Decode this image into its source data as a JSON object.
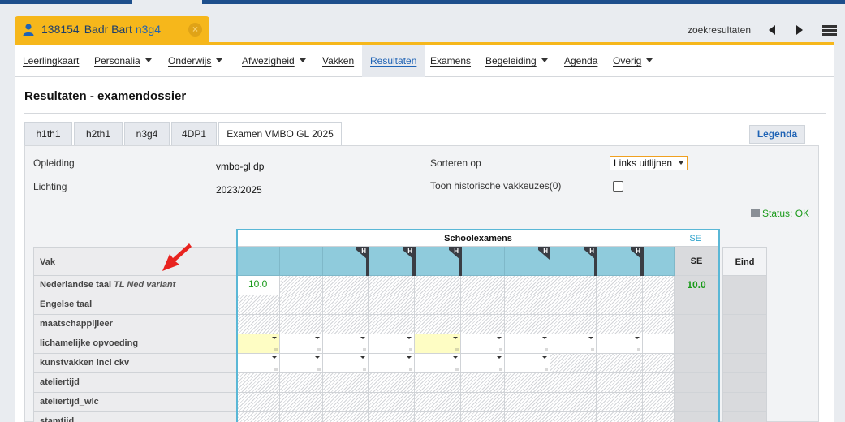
{
  "student": {
    "number": "138154",
    "name": "Badr Bart",
    "class": "n3g4"
  },
  "toolbar": {
    "search_results": "zoekresultaten"
  },
  "menu": [
    {
      "label": "Leerlingkaart",
      "has_caret": false
    },
    {
      "label": "Personalia",
      "has_caret": true
    },
    {
      "label": "Onderwijs",
      "has_caret": true
    },
    {
      "label": "Afwezigheid",
      "has_caret": true
    },
    {
      "label": "Vakken",
      "has_caret": false
    },
    {
      "label": "Resultaten",
      "has_caret": false,
      "active": true
    },
    {
      "label": "Examens",
      "has_caret": false
    },
    {
      "label": "Begeleiding",
      "has_caret": true
    },
    {
      "label": "Agenda",
      "has_caret": false
    },
    {
      "label": "Overig",
      "has_caret": true
    }
  ],
  "page": {
    "title": "Resultaten - examendossier"
  },
  "tabs": [
    {
      "label": "h1th1"
    },
    {
      "label": "h2th1"
    },
    {
      "label": "n3g4"
    },
    {
      "label": "4DP1"
    },
    {
      "label": "Examen VMBO GL 2025",
      "active": true
    }
  ],
  "legend_button": "Legenda",
  "info": {
    "opleiding_label": "Opleiding",
    "opleiding_value": "vmbo-gl dp",
    "lichting_label": "Lichting",
    "lichting_value": "2023/2025",
    "sort_label": "Sorteren op",
    "sort_value": "Links uitlijnen",
    "history_label": "Toon historische vakkeuzes(0)",
    "status": "Status: OK"
  },
  "grid": {
    "group_header": "Schoolexamens",
    "group_se": "SE",
    "vak_header": "Vak",
    "se_header": "SE",
    "eind_header": "Eind",
    "h_badge": "H",
    "rows": [
      {
        "vak": "Nederlandse taal",
        "variant": "TL Ned variant",
        "first": "10.0",
        "se": "10.0"
      },
      {
        "vak": "Engelse taal",
        "variant": "",
        "first": "",
        "se": ""
      },
      {
        "vak": "maatschappijleer",
        "variant": "",
        "first": "",
        "se": ""
      },
      {
        "vak": "lichamelijke opvoeding",
        "variant": "",
        "first": "",
        "se": ""
      },
      {
        "vak": "kunstvakken incl ckv",
        "variant": "",
        "first": "",
        "se": ""
      },
      {
        "vak": "ateliertijd",
        "variant": "",
        "first": "",
        "se": ""
      },
      {
        "vak": "ateliertijd_wlc",
        "variant": "",
        "first": "",
        "se": ""
      },
      {
        "vak": "stamtijd",
        "variant": "",
        "first": "",
        "se": ""
      }
    ]
  },
  "colors": {
    "accent": "#f6b71b",
    "header_blue": "#8fcbdc",
    "link_blue": "#1f63b5",
    "status_green": "#1a9a1a"
  }
}
